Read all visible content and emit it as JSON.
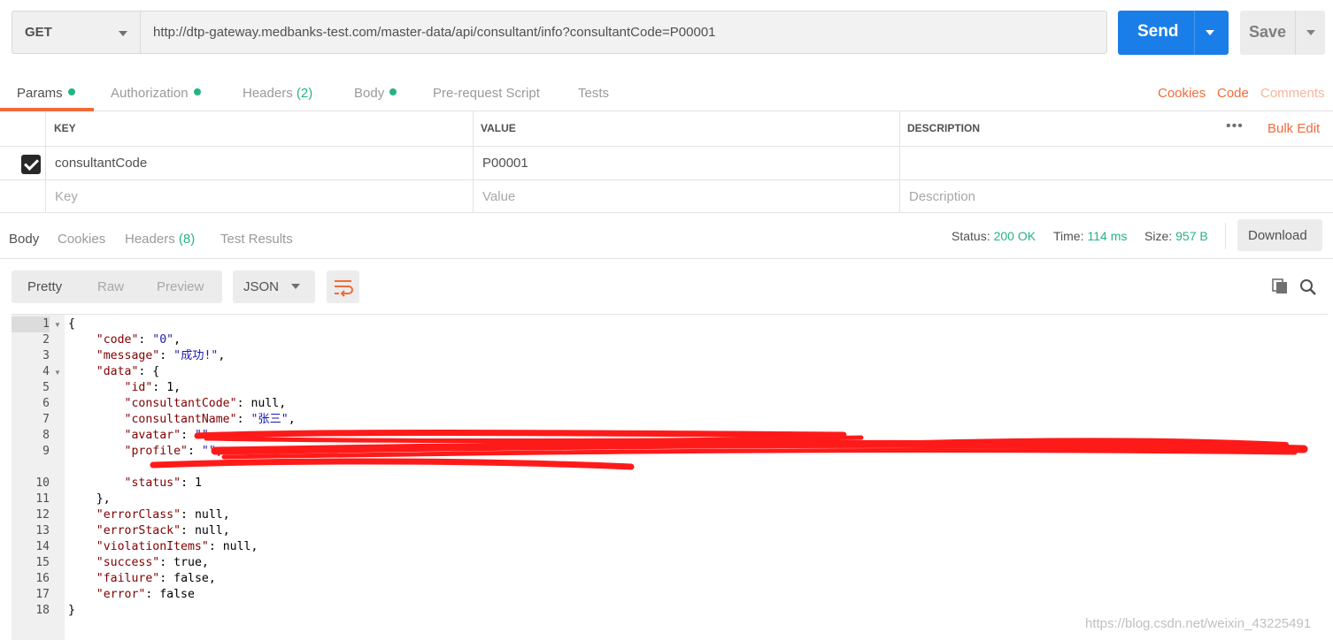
{
  "request": {
    "method": "GET",
    "url": "http://dtp-gateway.medbanks-test.com/master-data/api/consultant/info?consultantCode=P00001",
    "send_label": "Send",
    "save_label": "Save"
  },
  "request_tabs": {
    "params": "Params",
    "authorization": "Authorization",
    "headers": "Headers",
    "headers_count": "(2)",
    "body": "Body",
    "prerequest": "Pre-request Script",
    "tests": "Tests",
    "cookies": "Cookies",
    "code": "Code",
    "comments": "Comments"
  },
  "params_table": {
    "col_key": "KEY",
    "col_value": "VALUE",
    "col_description": "DESCRIPTION",
    "more": "•••",
    "bulk_edit": "Bulk Edit",
    "rows": [
      {
        "checked": true,
        "key": "consultantCode",
        "value": "P00001",
        "description": ""
      }
    ],
    "placeholder_key": "Key",
    "placeholder_value": "Value",
    "placeholder_description": "Description"
  },
  "response_tabs": {
    "body": "Body",
    "cookies": "Cookies",
    "headers": "Headers",
    "headers_count": "(8)",
    "test_results": "Test Results"
  },
  "response_status": {
    "status_label": "Status:",
    "status_value": "200 OK",
    "time_label": "Time:",
    "time_value": "114 ms",
    "size_label": "Size:",
    "size_value": "957 B",
    "download": "Download"
  },
  "format_toolbar": {
    "pretty": "Pretty",
    "raw": "Raw",
    "preview": "Preview",
    "language": "JSON"
  },
  "code_lines": [
    {
      "n": "1",
      "text": "{"
    },
    {
      "n": "2",
      "text": "    \"code\": \"0\","
    },
    {
      "n": "3",
      "text": "    \"message\": \"成功!\","
    },
    {
      "n": "4",
      "text": "    \"data\": {"
    },
    {
      "n": "5",
      "text": "        \"id\": 1,"
    },
    {
      "n": "6",
      "text": "        \"consultantCode\": null,"
    },
    {
      "n": "7",
      "text": "        \"consultantName\": \"张三\","
    },
    {
      "n": "8",
      "text": "        \"avatar\": \"\","
    },
    {
      "n": "9",
      "text": "        \"profile\": \"\","
    },
    {
      "n": "10",
      "text": "        \"status\": 1"
    },
    {
      "n": "11",
      "text": "    },"
    },
    {
      "n": "12",
      "text": "    \"errorClass\": null,"
    },
    {
      "n": "13",
      "text": "    \"errorStack\": null,"
    },
    {
      "n": "14",
      "text": "    \"violationItems\": null,"
    },
    {
      "n": "15",
      "text": "    \"success\": true,"
    },
    {
      "n": "16",
      "text": "    \"failure\": false,"
    },
    {
      "n": "17",
      "text": "    \"error\": false"
    },
    {
      "n": "18",
      "text": "}"
    }
  ],
  "watermark": "https://blog.csdn.net/weixin_43225491",
  "colors": {
    "accent": "#f26b3a",
    "send": "#1a7ee8",
    "success": "#26b47f",
    "redaction": "#ff1a1a"
  }
}
